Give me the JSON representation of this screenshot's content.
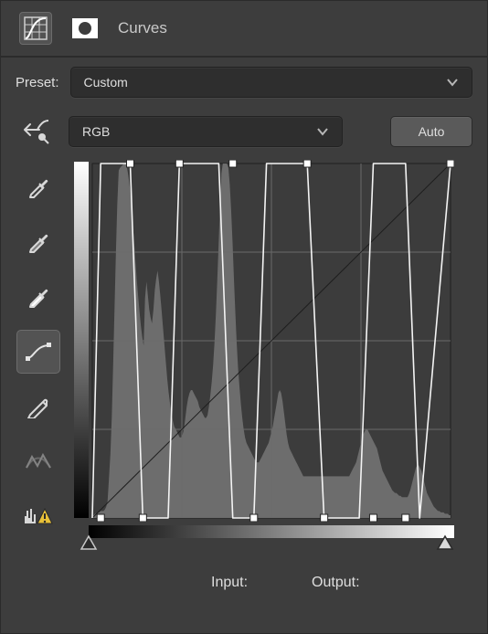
{
  "header": {
    "title": "Curves"
  },
  "preset": {
    "label": "Preset:",
    "value": "Custom"
  },
  "channel": {
    "value": "RGB"
  },
  "auto": {
    "label": "Auto"
  },
  "io": {
    "input_label": "Input:",
    "output_label": "Output:"
  },
  "tools": [
    {
      "name": "curves-icon"
    },
    {
      "name": "mask-icon"
    },
    {
      "name": "target-adjust-icon"
    },
    {
      "name": "eyedropper-black-icon"
    },
    {
      "name": "eyedropper-gray-icon"
    },
    {
      "name": "eyedropper-white-icon"
    },
    {
      "name": "curve-points-icon"
    },
    {
      "name": "pencil-icon"
    },
    {
      "name": "smooth-icon"
    },
    {
      "name": "clip-warning-icon"
    }
  ],
  "chart_data": {
    "type": "line",
    "title": "Tone Curve",
    "xlabel": "Input",
    "ylabel": "Output",
    "xlim": [
      0,
      255
    ],
    "ylim": [
      0,
      255
    ],
    "grid": true,
    "curve_points": [
      {
        "in": 0,
        "out": 0
      },
      {
        "in": 6,
        "out": 255
      },
      {
        "in": 27,
        "out": 255
      },
      {
        "in": 36,
        "out": 0
      },
      {
        "in": 54,
        "out": 0
      },
      {
        "in": 62,
        "out": 255
      },
      {
        "in": 90,
        "out": 255
      },
      {
        "in": 100,
        "out": 0
      },
      {
        "in": 115,
        "out": 0
      },
      {
        "in": 124,
        "out": 255
      },
      {
        "in": 153,
        "out": 255
      },
      {
        "in": 165,
        "out": 0
      },
      {
        "in": 190,
        "out": 0
      },
      {
        "in": 200,
        "out": 255
      },
      {
        "in": 223,
        "out": 255
      },
      {
        "in": 233,
        "out": 0
      },
      {
        "in": 255,
        "out": 255
      }
    ],
    "markers": [
      {
        "in": 6,
        "out": 0
      },
      {
        "in": 27,
        "out": 255
      },
      {
        "in": 36,
        "out": 0
      },
      {
        "in": 62,
        "out": 255
      },
      {
        "in": 100,
        "out": 255
      },
      {
        "in": 115,
        "out": 0
      },
      {
        "in": 153,
        "out": 255
      },
      {
        "in": 165,
        "out": 0
      },
      {
        "in": 200,
        "out": 0
      },
      {
        "in": 223,
        "out": 0
      },
      {
        "in": 255,
        "out": 255
      }
    ],
    "range_handles": {
      "black": 0,
      "white": 255
    },
    "histogram": [
      2,
      2,
      3,
      3,
      4,
      4,
      5,
      5,
      5,
      6,
      8,
      12,
      28,
      46,
      72,
      110,
      150,
      190,
      225,
      250,
      252,
      253,
      254,
      255,
      255,
      252,
      246,
      238,
      228,
      214,
      200,
      186,
      172,
      160,
      148,
      138,
      130,
      124,
      158,
      170,
      160,
      150,
      144,
      140,
      150,
      164,
      172,
      178,
      170,
      160,
      148,
      136,
      124,
      112,
      100,
      90,
      82,
      76,
      70,
      66,
      64,
      62,
      60,
      58,
      58,
      60,
      64,
      72,
      80,
      86,
      90,
      92,
      92,
      90,
      88,
      86,
      84,
      80,
      78,
      76,
      74,
      72,
      72,
      74,
      80,
      88,
      98,
      110,
      126,
      146,
      170,
      198,
      226,
      248,
      255,
      255,
      255,
      255,
      252,
      240,
      222,
      198,
      172,
      148,
      126,
      108,
      94,
      82,
      72,
      64,
      58,
      54,
      52,
      50,
      48,
      46,
      44,
      42,
      40,
      40,
      40,
      42,
      44,
      46,
      48,
      50,
      52,
      54,
      58,
      62,
      66,
      72,
      78,
      84,
      90,
      92,
      90,
      84,
      76,
      68,
      60,
      54,
      50,
      48,
      46,
      44,
      42,
      40,
      38,
      36,
      34,
      32,
      30,
      30,
      30,
      30,
      30,
      30,
      30,
      30,
      30,
      30,
      30,
      30,
      30,
      30,
      30,
      30,
      30,
      30,
      30,
      30,
      30,
      30,
      30,
      30,
      30,
      30,
      30,
      30,
      30,
      30,
      30,
      30,
      30,
      30,
      32,
      34,
      36,
      38,
      40,
      44,
      48,
      52,
      56,
      60,
      62,
      64,
      64,
      62,
      60,
      58,
      56,
      54,
      52,
      50,
      46,
      42,
      38,
      34,
      32,
      30,
      28,
      26,
      24,
      22,
      20,
      19,
      18,
      18,
      17,
      16,
      16,
      15,
      15,
      15,
      15,
      15,
      17,
      20,
      24,
      28,
      32,
      36,
      38,
      38,
      36,
      34,
      30,
      26,
      22,
      18,
      16,
      14,
      12,
      10,
      8,
      7,
      6,
      5,
      5,
      4,
      4,
      4,
      3,
      3,
      3,
      2,
      2
    ]
  }
}
